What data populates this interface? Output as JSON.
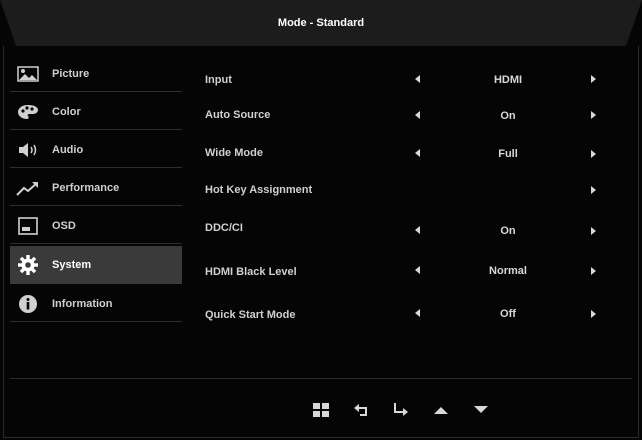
{
  "header": {
    "title": "Mode - Standard"
  },
  "sidebar": {
    "items": [
      {
        "label": "Picture",
        "icon": "picture-icon"
      },
      {
        "label": "Color",
        "icon": "palette-icon"
      },
      {
        "label": "Audio",
        "icon": "speaker-icon"
      },
      {
        "label": "Performance",
        "icon": "trend-up-icon"
      },
      {
        "label": "OSD",
        "icon": "osd-window-icon"
      },
      {
        "label": "System",
        "icon": "gear-icon",
        "active": true
      },
      {
        "label": "Information",
        "icon": "info-icon"
      }
    ]
  },
  "settings": {
    "rows": [
      {
        "label": "Input",
        "value": "HDMI"
      },
      {
        "label": "Auto Source",
        "value": "On"
      },
      {
        "label": "Wide Mode",
        "value": "Full"
      },
      {
        "label": "Hot Key Assignment",
        "value": ""
      },
      {
        "label": "DDC/CI",
        "value": "On"
      },
      {
        "label": "HDMI Black Level",
        "value": "Normal"
      },
      {
        "label": "Quick Start Mode",
        "value": "Off"
      }
    ]
  },
  "footer": {
    "icons": [
      "menu-grid-icon",
      "back-icon",
      "enter-icon",
      "up-arrow-icon",
      "down-arrow-icon"
    ]
  },
  "colors": {
    "background": "#050505",
    "titlebar": "#1c1c1c",
    "active_item": "#3a3a3a",
    "text": "#d8d8d8"
  }
}
